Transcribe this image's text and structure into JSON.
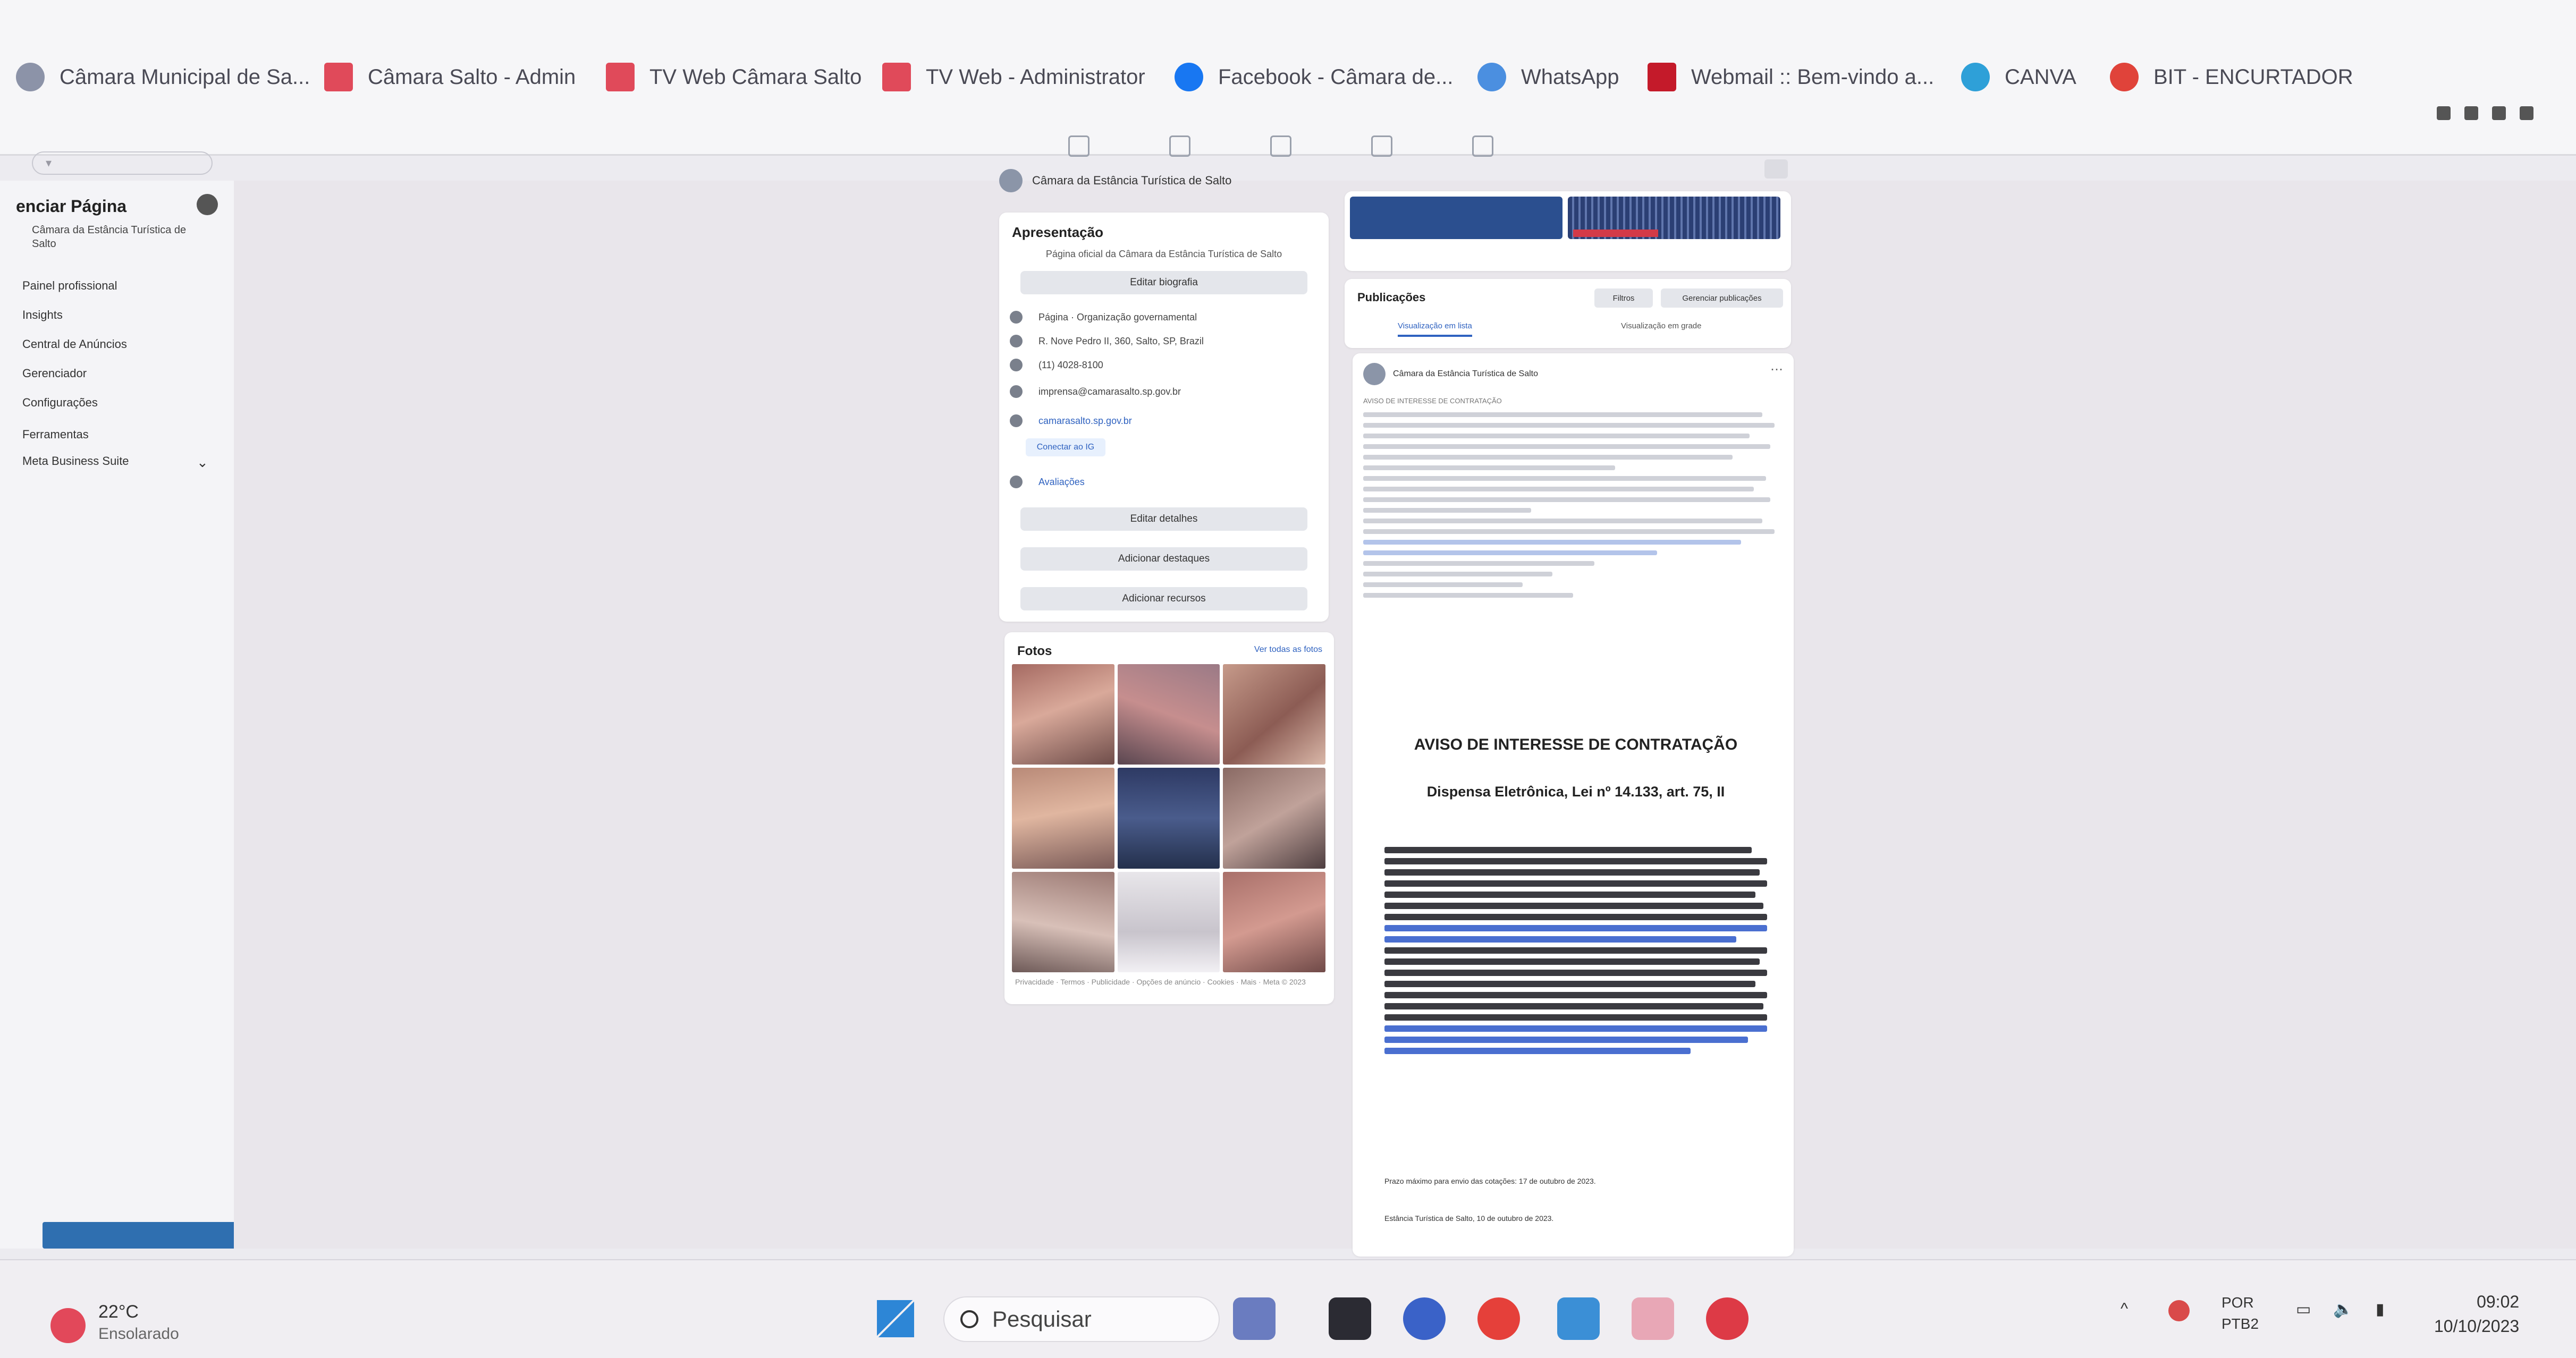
{
  "bookmarks": [
    {
      "label": "Câmara Municipal de Sa...",
      "icon": "camara-logo-icon"
    },
    {
      "label": "Câmara Salto - Admin",
      "icon": "joomla-icon"
    },
    {
      "label": "TV Web Câmara Salto",
      "icon": "joomla-icon"
    },
    {
      "label": "TV Web - Administrator",
      "icon": "joomla-icon"
    },
    {
      "label": "Facebook - Câmara de...",
      "icon": "facebook-icon"
    },
    {
      "label": "WhatsApp",
      "icon": "whatsapp-icon"
    },
    {
      "label": "Webmail :: Bem-vindo a...",
      "icon": "webmail-icon"
    },
    {
      "label": "CANVA",
      "icon": "canva-icon"
    },
    {
      "label": "BIT - ENCURTADOR",
      "icon": "bitly-icon"
    }
  ],
  "sidebar": {
    "title": "enciar Página",
    "page_name": "Câmara da Estância Turística de Salto",
    "items": [
      "Painel profissional",
      "Insights",
      "Central de Anúncios",
      "Gerenciador",
      "Configurações",
      "Ferramentas",
      "Meta Business Suite"
    ]
  },
  "page": {
    "name": "Câmara da Estância Turística de Salto"
  },
  "intro": {
    "title": "Apresentação",
    "description": "Página oficial da Câmara da Estância Turística de Salto",
    "edit_bio": "Editar biografia",
    "rows": [
      "Página · Organização governamental",
      "R. Nove Pedro II, 360, Salto, SP, Brazil",
      "(11) 4028-8100",
      "imprensa@camarasalto.sp.gov.br",
      "camarasalto.sp.gov.br"
    ],
    "instagram_chip": "Conectar ao IG",
    "rating": "Avaliações",
    "edit_details": "Editar detalhes",
    "add_featured": "Adicionar destaques",
    "add_links": "Adicionar recursos"
  },
  "photos": {
    "title": "Fotos",
    "see_all": "Ver todas as fotos",
    "footer": "Privacidade · Termos · Publicidade · Opções de anúncio · Cookies · Mais · Meta © 2023"
  },
  "publications": {
    "title": "Publicações",
    "filters": "Filtros",
    "manage": "Gerenciar publicações",
    "tab_list": "Visualização em lista",
    "tab_grid": "Visualização em grade"
  },
  "post": {
    "author": "Câmara da Estância Turística de Salto",
    "notice_heading": "AVISO DE INTERESSE DE CONTRATAÇÃO",
    "doc_title": "AVISO DE INTERESSE DE CONTRATAÇÃO",
    "doc_subtitle": "Dispensa Eletrônica, Lei nº 14.133, art. 75, II",
    "doc_deadline": "Prazo máximo para envio das cotações: 17 de outubro de 2023.",
    "doc_place_date": "Estância Turística de Salto, 10 de outubro de 2023."
  },
  "taskbar": {
    "temperature": "22°C",
    "condition": "Ensolarado",
    "search_placeholder": "Pesquisar",
    "lang_line1": "POR",
    "lang_line2": "PTB2",
    "time": "09:02",
    "date": "10/10/2023"
  }
}
